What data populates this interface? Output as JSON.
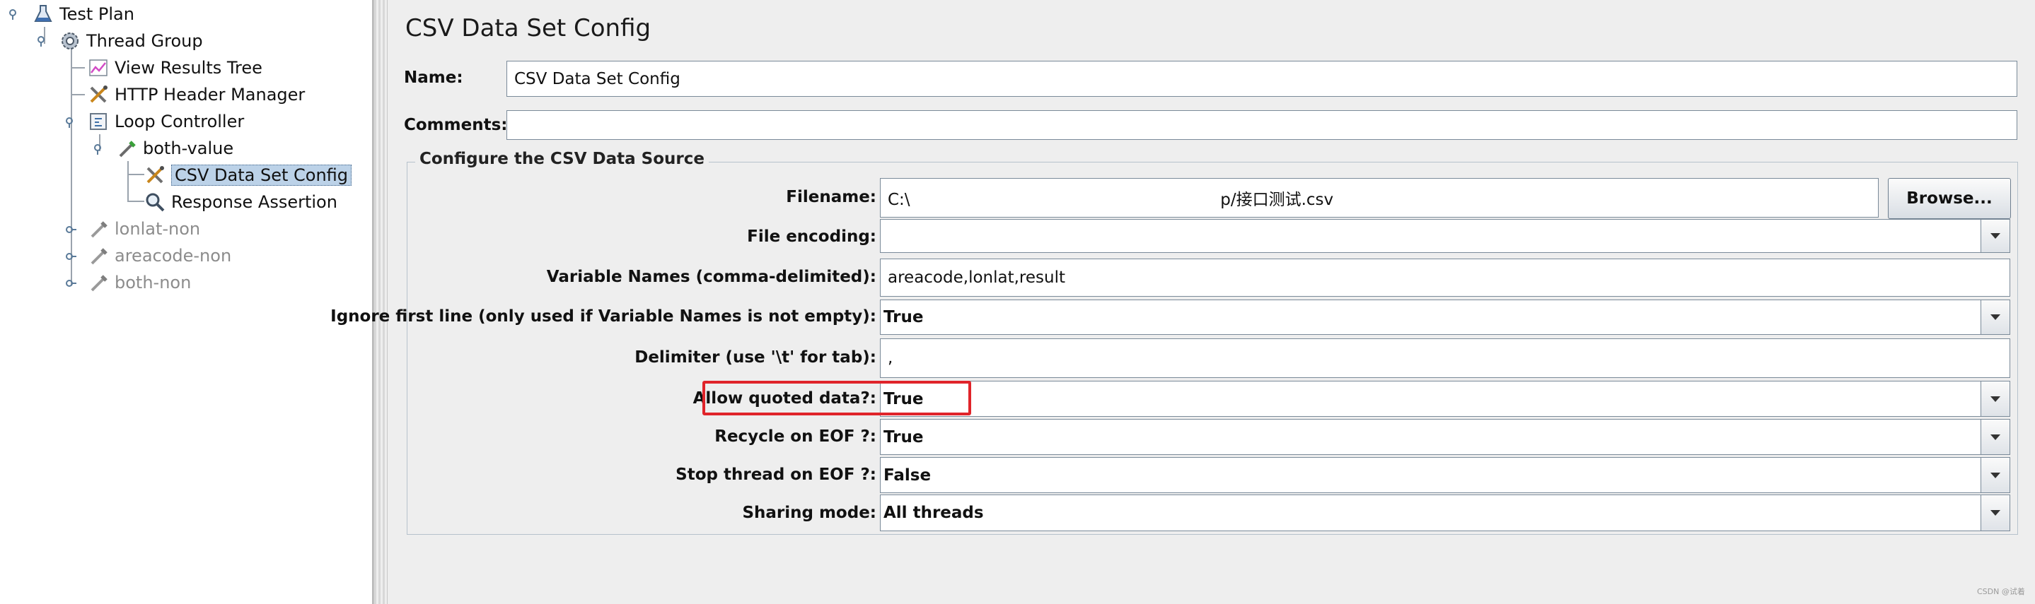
{
  "tree": {
    "nodes": [
      {
        "label": "Test Plan",
        "icon": "test-plan-flask-icon",
        "state": "normal"
      },
      {
        "label": "Thread Group",
        "icon": "thread-group-gear-icon",
        "state": "normal"
      },
      {
        "label": "View Results Tree",
        "icon": "results-chart-icon",
        "state": "normal"
      },
      {
        "label": "HTTP Header Manager",
        "icon": "wrench-screwdriver-icon",
        "state": "normal"
      },
      {
        "label": "Loop Controller",
        "icon": "loop-controller-icon",
        "state": "normal"
      },
      {
        "label": "both-value",
        "icon": "sampler-pipette-icon",
        "state": "normal"
      },
      {
        "label": "CSV Data Set Config",
        "icon": "wrench-screwdriver-icon",
        "state": "selected"
      },
      {
        "label": "Response Assertion",
        "icon": "magnifier-icon",
        "state": "normal"
      },
      {
        "label": "lonlat-non",
        "icon": "sampler-pipette-icon",
        "state": "disabled"
      },
      {
        "label": "areacode-non",
        "icon": "sampler-pipette-icon",
        "state": "disabled"
      },
      {
        "label": "both-non",
        "icon": "sampler-pipette-icon",
        "state": "disabled"
      }
    ]
  },
  "panel": {
    "title": "CSV Data Set Config",
    "name_label": "Name:",
    "name_value": "CSV Data Set Config",
    "comments_label": "Comments:",
    "comments_value": "",
    "group_title": "Configure the CSV Data Source",
    "fields": {
      "filename": {
        "label": "Filename:",
        "value": "C:\\                                                            p/接口测试.csv"
      },
      "browse_label": "Browse...",
      "encoding": {
        "label": "File encoding:",
        "value": ""
      },
      "varnames": {
        "label": "Variable Names (comma-delimited):",
        "value": "areacode,lonlat,result"
      },
      "ignore_first": {
        "label": "Ignore first line (only used if Variable Names is not empty):",
        "value": "True"
      },
      "delimiter": {
        "label": "Delimiter (use '\\t' for tab):",
        "value": ","
      },
      "quoted": {
        "label": "Allow quoted data?:",
        "value": "True"
      },
      "recycle": {
        "label": "Recycle on EOF ?:",
        "value": "True"
      },
      "stop_thread": {
        "label": "Stop thread on EOF ?:",
        "value": "False"
      },
      "sharing": {
        "label": "Sharing mode:",
        "value": "All threads"
      }
    }
  },
  "colors": {
    "highlight": "#e0242a",
    "selection": "#bcd2e8"
  },
  "watermark": "CSDN @试着"
}
